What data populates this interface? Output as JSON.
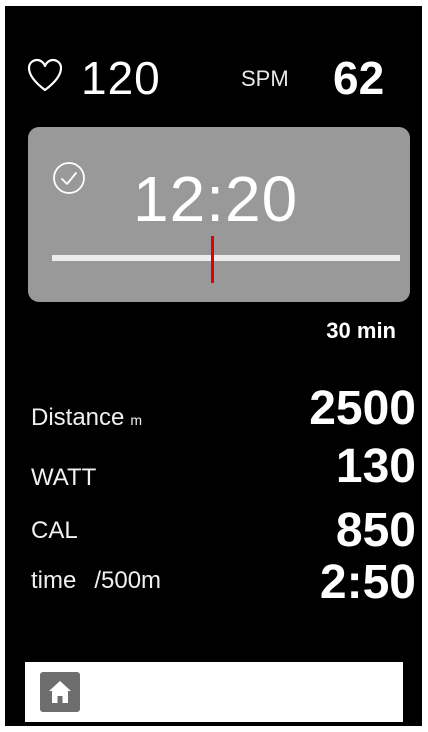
{
  "header": {
    "heart_rate": "120",
    "spm_label": "SPM",
    "spm_value": "62"
  },
  "timer": {
    "elapsed": "12:20",
    "progress_fraction": 0.46,
    "duration": "30 min"
  },
  "stats": [
    {
      "label": "Distance",
      "unit": "m",
      "value": "2500"
    },
    {
      "label": "WATT",
      "unit": "",
      "value": "130"
    },
    {
      "label": "CAL",
      "unit": "",
      "value": "850"
    },
    {
      "label": "time",
      "unit": "/500m",
      "value": "2:50"
    }
  ],
  "nav": {
    "home_icon": "home-icon"
  },
  "colors": {
    "background": "#000000",
    "panel": "#999999",
    "marker": "#e00000",
    "home_button": "#6e6e6e"
  }
}
